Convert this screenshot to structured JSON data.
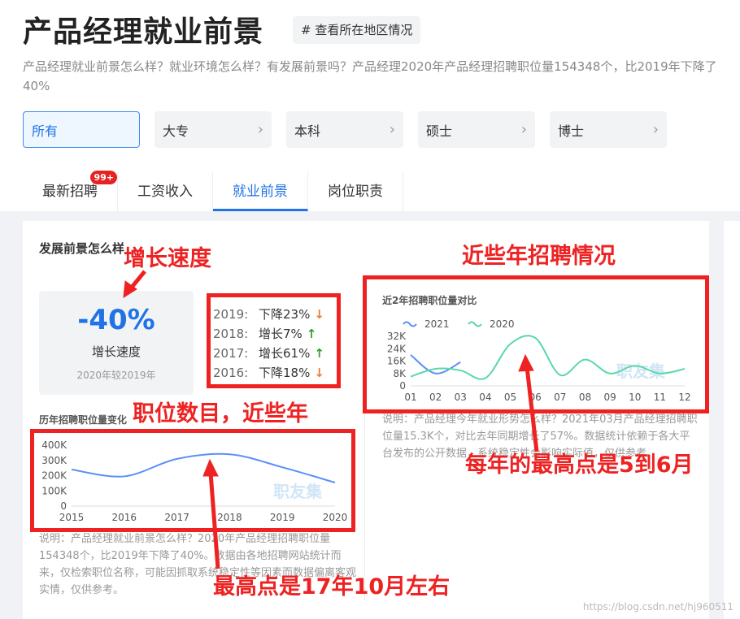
{
  "header": {
    "title": "产品经理就业前景",
    "region_button": "# 查看所在地区情况",
    "summary": "产品经理就业前景怎么样？就业环境怎么样？有发展前景吗？产品经理2020年产品经理招聘职位量154348个，比2019年下降了40%"
  },
  "education": [
    {
      "label": "所有"
    },
    {
      "label": "大专",
      "chevron": "›"
    },
    {
      "label": "本科",
      "chevron": "›"
    },
    {
      "label": "硕士",
      "chevron": "›"
    },
    {
      "label": "博士",
      "chevron": "›"
    }
  ],
  "tabs": [
    {
      "label": "最新招聘",
      "badge": "99+"
    },
    {
      "label": "工资收入"
    },
    {
      "label": "就业前景"
    },
    {
      "label": "岗位职责"
    }
  ],
  "prospect": {
    "section_title": "发展前景怎么样",
    "growth_value": "-40%",
    "growth_label": "增长速度",
    "growth_note": "2020年较2019年",
    "years": [
      {
        "year": "2019:",
        "change": "下降23%",
        "dir": "down"
      },
      {
        "year": "2018:",
        "change": "增长7%",
        "dir": "up"
      },
      {
        "year": "2017:",
        "change": "增长61%",
        "dir": "up"
      },
      {
        "year": "2016:",
        "change": "下降18%",
        "dir": "down"
      }
    ]
  },
  "history_chart_title": "历年招聘职位量变化",
  "history_note": "说明：产品经理就业前景怎么样？2020年产品经理招聘职位量154348个，比2019年下降了40%。数据由各地招聘网站统计而来，仅检索职位名称，可能因抓取系统稳定性等因素而数据偏离客观实情，仅供参考。",
  "compare_chart_title": "近2年招聘职位量对比",
  "compare_note": "说明：产品经理今年就业形势怎么样？2021年03月产品经理招聘职位量15.3K个，对比去年同期增长了57%。数据统计依赖于各大平台发布的公开数据，系统稳定性会影响实际值，仅供参考。",
  "watermark": "职友集",
  "annotations": {
    "growth": "增长速度",
    "recent": "近些年招聘情况",
    "positions": "职位数目，近些年",
    "peak_month": "每年的最高点是5到6月",
    "peak_year": "最高点是17年10月左右"
  },
  "url": "https://blog.csdn.net/hj960511",
  "colors": {
    "accent": "#1f73e6",
    "annotation_red": "#ee2222",
    "series_2021": "#5b8ff9",
    "series_2020": "#5ad8a6"
  },
  "chart_data": [
    {
      "type": "line",
      "title": "历年招聘职位量变化",
      "x": [
        "2015",
        "2016",
        "2017",
        "2018",
        "2019",
        "2020"
      ],
      "series": [
        {
          "values": [
            240000,
            195000,
            310000,
            340000,
            255000,
            154348
          ]
        }
      ],
      "yticks": [
        "400K",
        "300K",
        "200K",
        "100K",
        "0"
      ],
      "ylim": [
        0,
        400000
      ]
    },
    {
      "type": "line",
      "title": "近2年招聘职位量对比",
      "x": [
        "01",
        "02",
        "03",
        "04",
        "05",
        "06",
        "07",
        "08",
        "09",
        "10",
        "11",
        "12"
      ],
      "series": [
        {
          "name": "2021",
          "values": [
            20000,
            8000,
            15300
          ]
        },
        {
          "name": "2020",
          "values": [
            6000,
            11000,
            10000,
            5000,
            27000,
            31000,
            7000,
            17000,
            8000,
            13000,
            8000,
            11000
          ]
        }
      ],
      "yticks": [
        "32K",
        "24K",
        "16K",
        "8K",
        "0"
      ],
      "ylim": [
        0,
        32000
      ]
    }
  ]
}
